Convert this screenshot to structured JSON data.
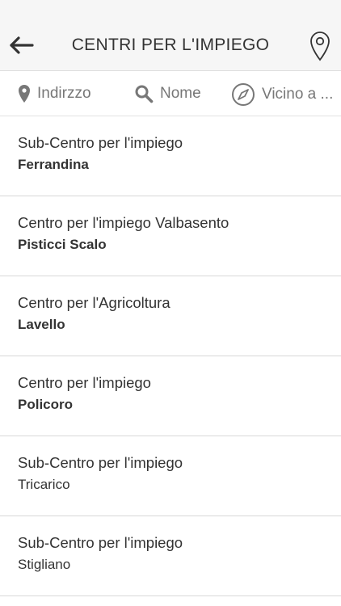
{
  "header": {
    "title": "CENTRI PER L'IMPIEGO",
    "back_icon": "arrow-left-icon",
    "map_icon": "map-pin-icon"
  },
  "filters": [
    {
      "label": "Indirzzo",
      "icon": "location-pin-icon"
    },
    {
      "label": "Nome",
      "icon": "search-icon"
    },
    {
      "label": "Vicino a ...",
      "icon": "compass-icon"
    }
  ],
  "list": [
    {
      "type": "Sub-Centro per l'impiego",
      "city": "Ferrandina",
      "bold": true
    },
    {
      "type": "Centro per l'impiego Valbasento",
      "city": "Pisticci Scalo",
      "bold": true
    },
    {
      "type": "Centro per l'Agricoltura",
      "city": "Lavello",
      "bold": true
    },
    {
      "type": "Centro per l'impiego",
      "city": "Policoro",
      "bold": true
    },
    {
      "type": "Sub-Centro per l'impiego",
      "city": "Tricarico",
      "bold": false
    },
    {
      "type": "Sub-Centro per l'impiego",
      "city": "Stigliano",
      "bold": false
    }
  ],
  "colors": {
    "header_bg": "#f6f6f6",
    "text": "#333333",
    "muted": "#777777",
    "divider": "#d8d8d8"
  }
}
